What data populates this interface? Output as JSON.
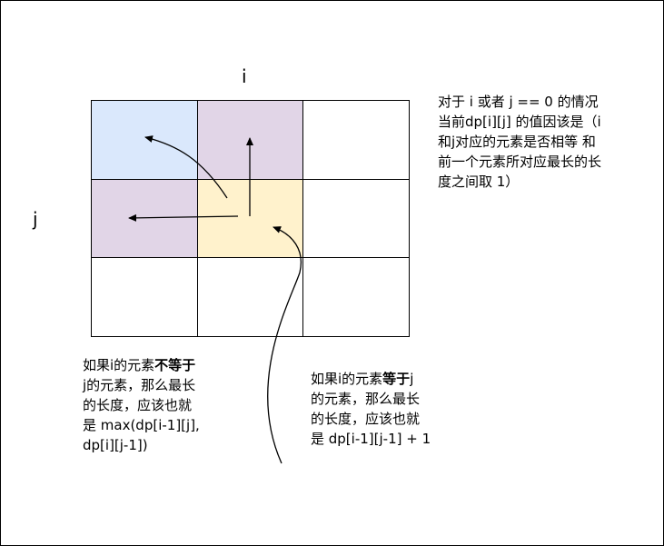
{
  "axis": {
    "i": "i",
    "j": "j"
  },
  "grid": {
    "rows": 3,
    "cols": 3,
    "colors": [
      [
        "#dae8fc",
        "#e1d5e7",
        "#ffffff"
      ],
      [
        "#e1d5e7",
        "#fff2cc",
        "#ffffff"
      ],
      [
        "#ffffff",
        "#ffffff",
        "#ffffff"
      ]
    ]
  },
  "notes": {
    "top_right": "对于 i 或者 j == 0 的情况\n当前dp[i][j] 的值因该是（i\n和j对应的元素是否相等 和\n前一个元素所对应最长的长\n度之间取 1）",
    "left": {
      "part1": "如果i的元素",
      "bold": "不等于",
      "part2": "\nj的元素，那么最长\n的长度，应该也就\n是 max(dp[i-1][j],\ndp[i][j-1])"
    },
    "right": {
      "part1": "如果i的元素",
      "bold": "等于",
      "part2": "j\n的元素，那么最长\n的长度，应该也就\n是 dp[i-1][j-1] + 1"
    }
  }
}
